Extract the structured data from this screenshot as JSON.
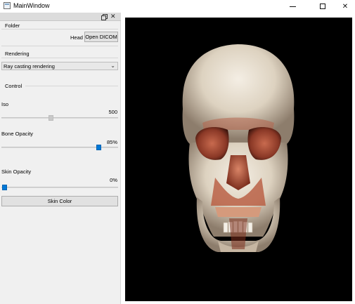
{
  "window": {
    "title": "MainWindow",
    "controls": {
      "minimize_icon": "minimize-icon",
      "maximize_icon": "maximize-icon",
      "close_icon": "close-icon"
    }
  },
  "dock": {
    "close_glyph": "✕",
    "folder": {
      "title": "Folder",
      "file_label": "Head",
      "open_button": "Open DICOM"
    },
    "rendering": {
      "title": "Rendering",
      "mode_selected": "Ray casting rendering"
    },
    "control": {
      "title": "Control",
      "iso": {
        "label": "Iso",
        "value": "500",
        "level": 0.42
      },
      "bone_opacity": {
        "label": "Bone Opacity",
        "value": "85%",
        "level": 0.85
      },
      "skin_opacity": {
        "label": "Skin Opacity",
        "value": "0%",
        "level": 0.0
      },
      "skin_color_button": "Skin Color"
    }
  },
  "viewport": {
    "content": "volume-rendered skull",
    "background": "#000000",
    "bone_color": "#e8e0d2",
    "tissue_color": "#b8553a"
  },
  "colors": {
    "accent": "#0078d7",
    "panel_bg": "#f0f0f0"
  }
}
